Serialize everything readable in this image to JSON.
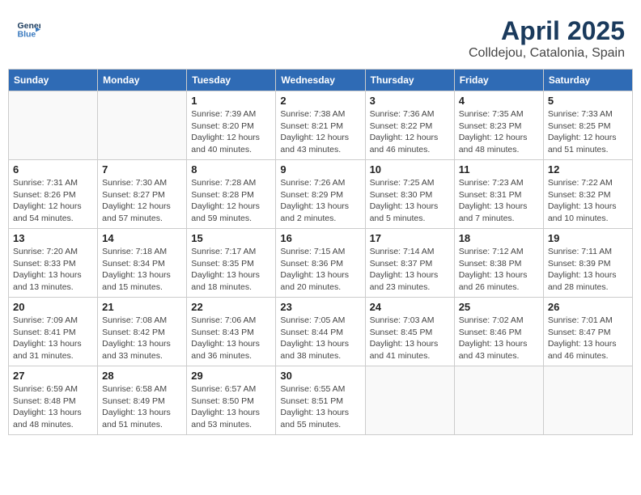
{
  "header": {
    "logo_line1": "General",
    "logo_line2": "Blue",
    "month_year": "April 2025",
    "location": "Colldejou, Catalonia, Spain"
  },
  "weekdays": [
    "Sunday",
    "Monday",
    "Tuesday",
    "Wednesday",
    "Thursday",
    "Friday",
    "Saturday"
  ],
  "weeks": [
    [
      {
        "day": "",
        "info": ""
      },
      {
        "day": "",
        "info": ""
      },
      {
        "day": "1",
        "info": "Sunrise: 7:39 AM\nSunset: 8:20 PM\nDaylight: 12 hours\nand 40 minutes."
      },
      {
        "day": "2",
        "info": "Sunrise: 7:38 AM\nSunset: 8:21 PM\nDaylight: 12 hours\nand 43 minutes."
      },
      {
        "day": "3",
        "info": "Sunrise: 7:36 AM\nSunset: 8:22 PM\nDaylight: 12 hours\nand 46 minutes."
      },
      {
        "day": "4",
        "info": "Sunrise: 7:35 AM\nSunset: 8:23 PM\nDaylight: 12 hours\nand 48 minutes."
      },
      {
        "day": "5",
        "info": "Sunrise: 7:33 AM\nSunset: 8:25 PM\nDaylight: 12 hours\nand 51 minutes."
      }
    ],
    [
      {
        "day": "6",
        "info": "Sunrise: 7:31 AM\nSunset: 8:26 PM\nDaylight: 12 hours\nand 54 minutes."
      },
      {
        "day": "7",
        "info": "Sunrise: 7:30 AM\nSunset: 8:27 PM\nDaylight: 12 hours\nand 57 minutes."
      },
      {
        "day": "8",
        "info": "Sunrise: 7:28 AM\nSunset: 8:28 PM\nDaylight: 12 hours\nand 59 minutes."
      },
      {
        "day": "9",
        "info": "Sunrise: 7:26 AM\nSunset: 8:29 PM\nDaylight: 13 hours\nand 2 minutes."
      },
      {
        "day": "10",
        "info": "Sunrise: 7:25 AM\nSunset: 8:30 PM\nDaylight: 13 hours\nand 5 minutes."
      },
      {
        "day": "11",
        "info": "Sunrise: 7:23 AM\nSunset: 8:31 PM\nDaylight: 13 hours\nand 7 minutes."
      },
      {
        "day": "12",
        "info": "Sunrise: 7:22 AM\nSunset: 8:32 PM\nDaylight: 13 hours\nand 10 minutes."
      }
    ],
    [
      {
        "day": "13",
        "info": "Sunrise: 7:20 AM\nSunset: 8:33 PM\nDaylight: 13 hours\nand 13 minutes."
      },
      {
        "day": "14",
        "info": "Sunrise: 7:18 AM\nSunset: 8:34 PM\nDaylight: 13 hours\nand 15 minutes."
      },
      {
        "day": "15",
        "info": "Sunrise: 7:17 AM\nSunset: 8:35 PM\nDaylight: 13 hours\nand 18 minutes."
      },
      {
        "day": "16",
        "info": "Sunrise: 7:15 AM\nSunset: 8:36 PM\nDaylight: 13 hours\nand 20 minutes."
      },
      {
        "day": "17",
        "info": "Sunrise: 7:14 AM\nSunset: 8:37 PM\nDaylight: 13 hours\nand 23 minutes."
      },
      {
        "day": "18",
        "info": "Sunrise: 7:12 AM\nSunset: 8:38 PM\nDaylight: 13 hours\nand 26 minutes."
      },
      {
        "day": "19",
        "info": "Sunrise: 7:11 AM\nSunset: 8:39 PM\nDaylight: 13 hours\nand 28 minutes."
      }
    ],
    [
      {
        "day": "20",
        "info": "Sunrise: 7:09 AM\nSunset: 8:41 PM\nDaylight: 13 hours\nand 31 minutes."
      },
      {
        "day": "21",
        "info": "Sunrise: 7:08 AM\nSunset: 8:42 PM\nDaylight: 13 hours\nand 33 minutes."
      },
      {
        "day": "22",
        "info": "Sunrise: 7:06 AM\nSunset: 8:43 PM\nDaylight: 13 hours\nand 36 minutes."
      },
      {
        "day": "23",
        "info": "Sunrise: 7:05 AM\nSunset: 8:44 PM\nDaylight: 13 hours\nand 38 minutes."
      },
      {
        "day": "24",
        "info": "Sunrise: 7:03 AM\nSunset: 8:45 PM\nDaylight: 13 hours\nand 41 minutes."
      },
      {
        "day": "25",
        "info": "Sunrise: 7:02 AM\nSunset: 8:46 PM\nDaylight: 13 hours\nand 43 minutes."
      },
      {
        "day": "26",
        "info": "Sunrise: 7:01 AM\nSunset: 8:47 PM\nDaylight: 13 hours\nand 46 minutes."
      }
    ],
    [
      {
        "day": "27",
        "info": "Sunrise: 6:59 AM\nSunset: 8:48 PM\nDaylight: 13 hours\nand 48 minutes."
      },
      {
        "day": "28",
        "info": "Sunrise: 6:58 AM\nSunset: 8:49 PM\nDaylight: 13 hours\nand 51 minutes."
      },
      {
        "day": "29",
        "info": "Sunrise: 6:57 AM\nSunset: 8:50 PM\nDaylight: 13 hours\nand 53 minutes."
      },
      {
        "day": "30",
        "info": "Sunrise: 6:55 AM\nSunset: 8:51 PM\nDaylight: 13 hours\nand 55 minutes."
      },
      {
        "day": "",
        "info": ""
      },
      {
        "day": "",
        "info": ""
      },
      {
        "day": "",
        "info": ""
      }
    ]
  ]
}
